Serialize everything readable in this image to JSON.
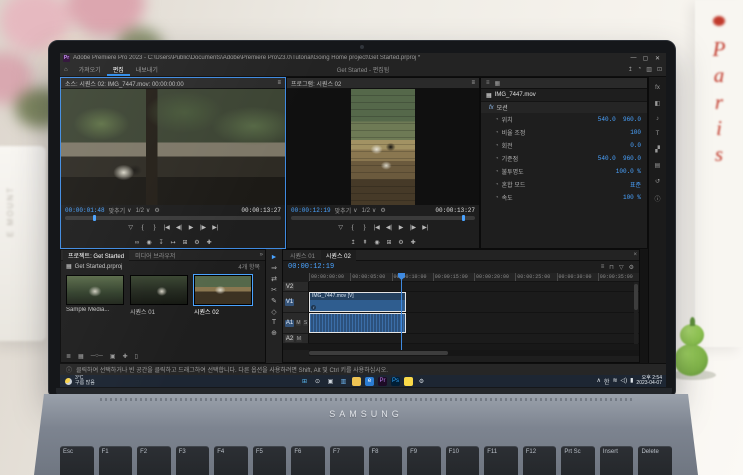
{
  "ui": {
    "menu_glyph": "≡",
    "chevron_right": "»",
    "dropdown": "∨",
    "wrench": "⚙",
    "stopwatch": "◔",
    "fx": "fx",
    "info": "ⓘ",
    "film": "▦",
    "home": "⌂",
    "tab_close": "×",
    "accent_blue": "#2d8ceb"
  },
  "scene": {
    "candle_label": "E MOUNT",
    "poster_letters": [
      "P",
      "a",
      "r",
      "i",
      "s"
    ],
    "laptop_brand": "SAMSUNG",
    "keys": [
      "Esc",
      "F1",
      "F2",
      "F3",
      "F4",
      "F5",
      "F6",
      "F7",
      "F8",
      "F9",
      "F10",
      "F11",
      "F12",
      "Prt Sc",
      "Insert",
      "Delete"
    ]
  },
  "titlebar": {
    "app_badge": "Pr",
    "app_title": "Adobe Premiere Pro 2023 - C:\\Users\\Public\\Documents\\Adobe\\Premiere Pro\\23.0\\Tutorial\\Going Home project\\Get Started.prproj *",
    "window_controls": [
      {
        "name": "minimize-button",
        "glyph": "—"
      },
      {
        "name": "restore-button",
        "glyph": "▢"
      },
      {
        "name": "close-button",
        "glyph": "✕"
      }
    ]
  },
  "workspace": {
    "tabs": [
      {
        "label": "가져오기"
      },
      {
        "label": "편집",
        "active": true
      },
      {
        "label": "내보내기"
      }
    ],
    "doc_label": "Get Started - 편집됨",
    "icons": [
      {
        "name": "quick-export-icon",
        "glyph": "↥"
      },
      {
        "name": "progress-dashboard-icon",
        "glyph": "◔"
      },
      {
        "name": "workspaces-icon",
        "glyph": "▥"
      },
      {
        "name": "fullscreen-icon",
        "glyph": "⊡"
      }
    ]
  },
  "source": {
    "tab_title": "소스: 시퀀스 02: IMG_7447.mov: 00:00:00:00",
    "tc_current": "00:00:01:48",
    "fit_label": "맞추기",
    "zoom_label": "1/2",
    "tc_total": "00:00:13:27",
    "icons_row1": [
      {
        "name": "add-marker-icon",
        "glyph": "▽"
      },
      {
        "name": "mark-in-icon",
        "glyph": "{"
      },
      {
        "name": "mark-out-icon",
        "glyph": "}"
      },
      {
        "name": "go-to-in-icon",
        "glyph": "|◀"
      },
      {
        "name": "step-back-icon",
        "glyph": "◀|"
      },
      {
        "name": "play-icon",
        "glyph": "▶"
      },
      {
        "name": "step-forward-icon",
        "glyph": "|▶"
      },
      {
        "name": "go-to-out-icon",
        "glyph": "▶|"
      }
    ],
    "icons_row2": [
      {
        "name": "loop-icon",
        "glyph": "∞"
      },
      {
        "name": "export-frame-icon",
        "glyph": "◉"
      },
      {
        "name": "insert-icon",
        "glyph": "↧"
      },
      {
        "name": "overwrite-icon",
        "glyph": "↦"
      },
      {
        "name": "comparison-view-icon",
        "glyph": "⊞"
      },
      {
        "name": "settings-menu-icon",
        "glyph": "⚙"
      },
      {
        "name": "button-editor-icon",
        "glyph": "✚"
      }
    ]
  },
  "program": {
    "tab_title": "프로그램: 시퀀스 02",
    "tc_current": "00:00:12:19",
    "fit_label": "맞추기",
    "zoom_label": "1/2",
    "tc_total": "00:00:13:27",
    "icons_row1": [
      {
        "name": "add-marker-icon",
        "glyph": "▽"
      },
      {
        "name": "mark-in-icon",
        "glyph": "{"
      },
      {
        "name": "mark-out-icon",
        "glyph": "}"
      },
      {
        "name": "go-to-in-icon",
        "glyph": "|◀"
      },
      {
        "name": "step-back-icon",
        "glyph": "◀|"
      },
      {
        "name": "play-icon",
        "glyph": "▶"
      },
      {
        "name": "step-forward-icon",
        "glyph": "|▶"
      },
      {
        "name": "go-to-out-icon",
        "glyph": "▶|"
      }
    ],
    "icons_row2": [
      {
        "name": "lift-icon",
        "glyph": "↥"
      },
      {
        "name": "extract-icon",
        "glyph": "⇞"
      },
      {
        "name": "export-frame-icon",
        "glyph": "◉"
      },
      {
        "name": "comparison-view-icon",
        "glyph": "⊞"
      },
      {
        "name": "settings-menu-icon",
        "glyph": "⚙"
      },
      {
        "name": "button-editor-icon",
        "glyph": "✚"
      }
    ]
  },
  "effects": {
    "clip_name": "IMG_7447.mov",
    "section_label": "모션",
    "rows": [
      {
        "label": "위치",
        "value": "540.0  960.0"
      },
      {
        "label": "비율 조정",
        "value": "100"
      },
      {
        "label": "회전",
        "value": "0.0"
      },
      {
        "label": "기준점",
        "value": "540.0  960.0"
      },
      {
        "label": "불투명도",
        "value": "100.0 %"
      },
      {
        "label": "혼합 모드",
        "value": "표준"
      },
      {
        "label": "속도",
        "value": "100 %"
      }
    ],
    "dock_icons": [
      {
        "name": "effects-panel-icon",
        "glyph": "fx"
      },
      {
        "name": "lumetri-panel-icon",
        "glyph": "◧"
      },
      {
        "name": "essential-sound-panel-icon",
        "glyph": "♪"
      },
      {
        "name": "text-panel-icon",
        "glyph": "T"
      },
      {
        "name": "transitions-panel-icon",
        "glyph": "▞"
      },
      {
        "name": "markers-panel-icon",
        "glyph": "▤"
      },
      {
        "name": "history-panel-icon",
        "glyph": "↺"
      },
      {
        "name": "info-panel-icon",
        "glyph": "ⓘ"
      }
    ]
  },
  "project": {
    "tabs": [
      {
        "label": "프로젝트: Get Started",
        "active": true
      },
      {
        "label": "미디어 브라우저"
      }
    ],
    "file_label": "Get Started.prproj",
    "count_label": "4개 항목",
    "items": [
      {
        "label": "Sample Media...",
        "media": true
      },
      {
        "label": "시퀀스 01",
        "seq1": true
      },
      {
        "label": "시퀀스 02",
        "seq2": true,
        "selected": true
      }
    ],
    "footer_icons": [
      {
        "name": "list-view-icon",
        "glyph": "≣"
      },
      {
        "name": "icon-view-icon",
        "glyph": "▦"
      },
      {
        "name": "thumbnail-zoom-slider",
        "glyph": "─○─"
      },
      {
        "name": "new-bin-icon",
        "glyph": "▣"
      },
      {
        "name": "new-item-icon",
        "glyph": "✚"
      },
      {
        "name": "delete-icon",
        "glyph": "▯"
      }
    ]
  },
  "tools": [
    {
      "name": "selection-tool",
      "glyph": "►"
    },
    {
      "name": "track-select-tool",
      "glyph": "⇒"
    },
    {
      "name": "ripple-edit-tool",
      "glyph": "⇄"
    },
    {
      "name": "razor-tool",
      "glyph": "✂"
    },
    {
      "name": "pen-tool",
      "glyph": "✎"
    },
    {
      "name": "hand-tool",
      "glyph": "◇"
    },
    {
      "name": "type-tool",
      "glyph": "T"
    },
    {
      "name": "zoom-tool",
      "glyph": "⊕"
    }
  ],
  "timeline": {
    "tabs": [
      {
        "label": "시퀀스 01"
      },
      {
        "label": "시퀀스 02",
        "active": true
      }
    ],
    "tc_current": "00:00:12:19",
    "header_icons": [
      {
        "name": "nest-toggle-icon",
        "glyph": "≡"
      },
      {
        "name": "snap-icon",
        "glyph": "⊓"
      },
      {
        "name": "marker-icon",
        "glyph": "▽"
      },
      {
        "name": "timeline-settings-icon",
        "glyph": "⚙"
      }
    ],
    "ruler": [
      "00:00:00:00",
      "00:00:05:00",
      "00:00:10:00",
      "00:00:15:00",
      "00:00:20:00",
      "00:00:25:00",
      "00:00:30:00",
      "00:00:35:00"
    ],
    "tracks": [
      {
        "label": "V2"
      },
      {
        "label": "V1"
      },
      {
        "label": "A1"
      },
      {
        "label": "A2"
      }
    ],
    "clip_video_label": "IMG_7447.mov [V]",
    "mute_label": "M",
    "solo_label": "S"
  },
  "statusbar": {
    "hint": "클릭하여 선택하거나 빈 공간을 클릭하고 드래그하여 선택합니다. 다른 옵션을 사용하려면 Shift, Alt 및 Ctrl 키를 사용하십시오."
  },
  "taskbar": {
    "weather_temp": "3°C",
    "weather_desc": "구름 많음",
    "icons": [
      {
        "name": "start-button",
        "glyph": "⊞",
        "fg": "#58b7f0"
      },
      {
        "name": "search-button",
        "glyph": "⊙",
        "fg": "#dfe5ea"
      },
      {
        "name": "task-view-button",
        "glyph": "▣",
        "fg": "#cfd6dd"
      },
      {
        "name": "widgets-button",
        "glyph": "▥",
        "fg": "#6fb7f2"
      },
      {
        "name": "file-explorer-button",
        "glyph": "",
        "bg": "#eec353"
      },
      {
        "name": "edge-button",
        "glyph": "e",
        "bg": "#2b7cd3",
        "fg": "#ffffff"
      },
      {
        "name": "premiere-button",
        "glyph": "Pr",
        "bg": "#1d0b26",
        "fg": "#b57ee8"
      },
      {
        "name": "photoshop-button",
        "glyph": "Ps",
        "bg": "#001e36",
        "fg": "#31a8ff"
      },
      {
        "name": "kakaotalk-button",
        "glyph": "",
        "bg": "#f9d949"
      },
      {
        "name": "settings-button",
        "glyph": "⚙",
        "fg": "#cfd6dd"
      }
    ],
    "tray": [
      {
        "name": "tray-chevron-icon",
        "glyph": "∧"
      },
      {
        "name": "ime-korean-indicator",
        "glyph": "한"
      },
      {
        "name": "network-icon",
        "glyph": "≋"
      },
      {
        "name": "volume-icon",
        "glyph": "◁)"
      },
      {
        "name": "battery-icon",
        "glyph": "▮"
      }
    ],
    "time": "오후 2:54",
    "date": "2023-04-07"
  }
}
